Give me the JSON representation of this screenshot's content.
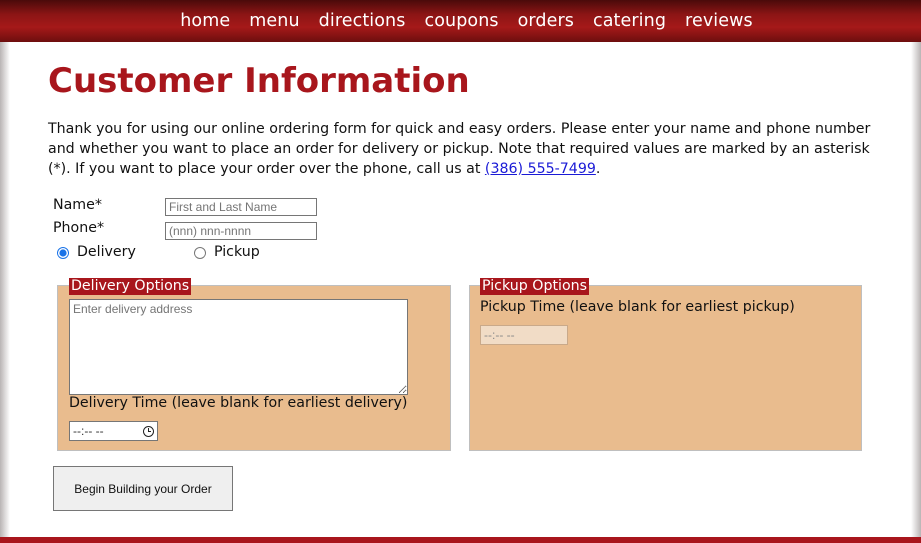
{
  "nav": {
    "items": [
      "home",
      "menu",
      "directions",
      "coupons",
      "orders",
      "catering",
      "reviews"
    ]
  },
  "page": {
    "title": "Customer Information",
    "intro_text": "Thank you for using our online ordering form for quick and easy orders. Please enter your name and phone number and whether you want to place an order for delivery or pickup. Note that required values are marked by an asterisk (*). If you want to place your order over the phone, call us at ",
    "phone_link": "(386) 555-7499",
    "intro_end": "."
  },
  "form": {
    "name_label": "Name*",
    "name_placeholder": "First and Last Name",
    "phone_label": "Phone*",
    "phone_placeholder": "(nnn) nnn-nnnn",
    "delivery_radio_label": "Delivery",
    "pickup_radio_label": "Pickup",
    "selected_method": "Delivery",
    "submit_label": "Begin Building your Order"
  },
  "delivery_panel": {
    "legend": "Delivery Options",
    "address_placeholder": "Enter delivery address",
    "time_label": "Delivery Time (leave blank for earliest delivery)",
    "time_value": "--:-- --"
  },
  "pickup_panel": {
    "legend": "Pickup Options",
    "time_label": "Pickup Time (leave blank for earliest pickup)",
    "time_value": "--:-- --"
  },
  "colors": {
    "brand_red": "#a8161c",
    "panel_bg": "#e9bc8e"
  }
}
